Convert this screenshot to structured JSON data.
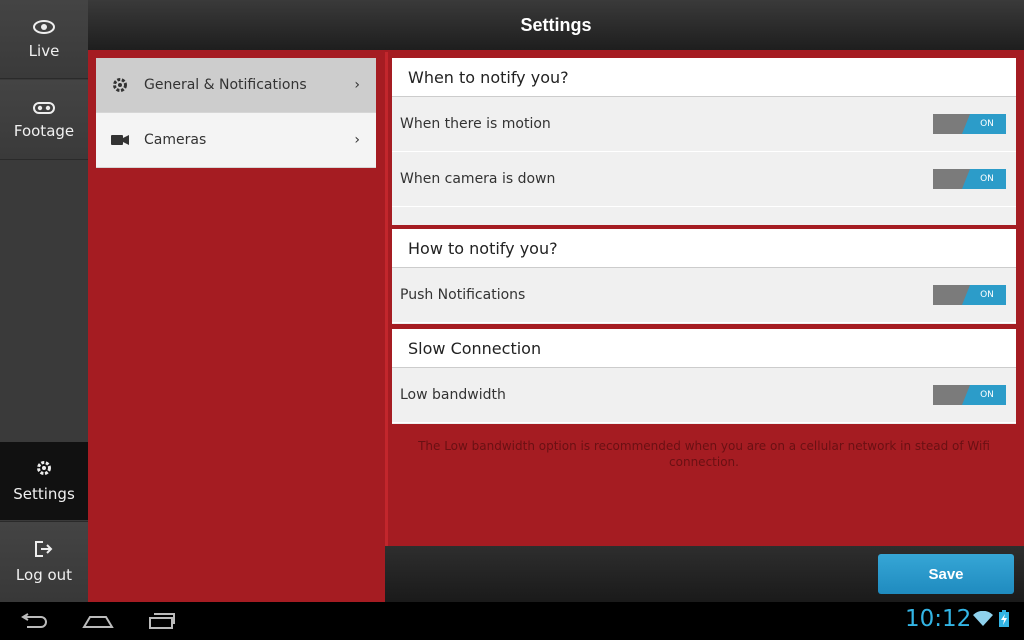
{
  "header": {
    "title": "Settings"
  },
  "nav": {
    "live": "Live",
    "footage": "Footage",
    "settings": "Settings",
    "logout": "Log out"
  },
  "categories": [
    {
      "label": "General & Notifications",
      "icon": "gear-icon",
      "chevron": "›"
    },
    {
      "label": "Cameras",
      "icon": "video-camera-icon",
      "chevron": "›"
    }
  ],
  "sections": {
    "when": {
      "title": "When to notify you?",
      "rows": [
        {
          "label": "When there is motion",
          "toggle": "ON"
        },
        {
          "label": "When camera is down",
          "toggle": "ON"
        }
      ]
    },
    "how": {
      "title": "How to notify you?",
      "rows": [
        {
          "label": "Push Notifications",
          "toggle": "ON"
        }
      ]
    },
    "slow": {
      "title": "Slow Connection",
      "rows": [
        {
          "label": "Low bandwidth",
          "toggle": "ON"
        }
      ]
    }
  },
  "note": "The Low bandwidth option is recommended when you are on a cellular network in stead of Wifi connection.",
  "save_label": "Save",
  "system": {
    "time": "10:12"
  },
  "colors": {
    "accent": "#2c9cc9",
    "brand_red": "#a51c22",
    "clock": "#33b5e5"
  }
}
